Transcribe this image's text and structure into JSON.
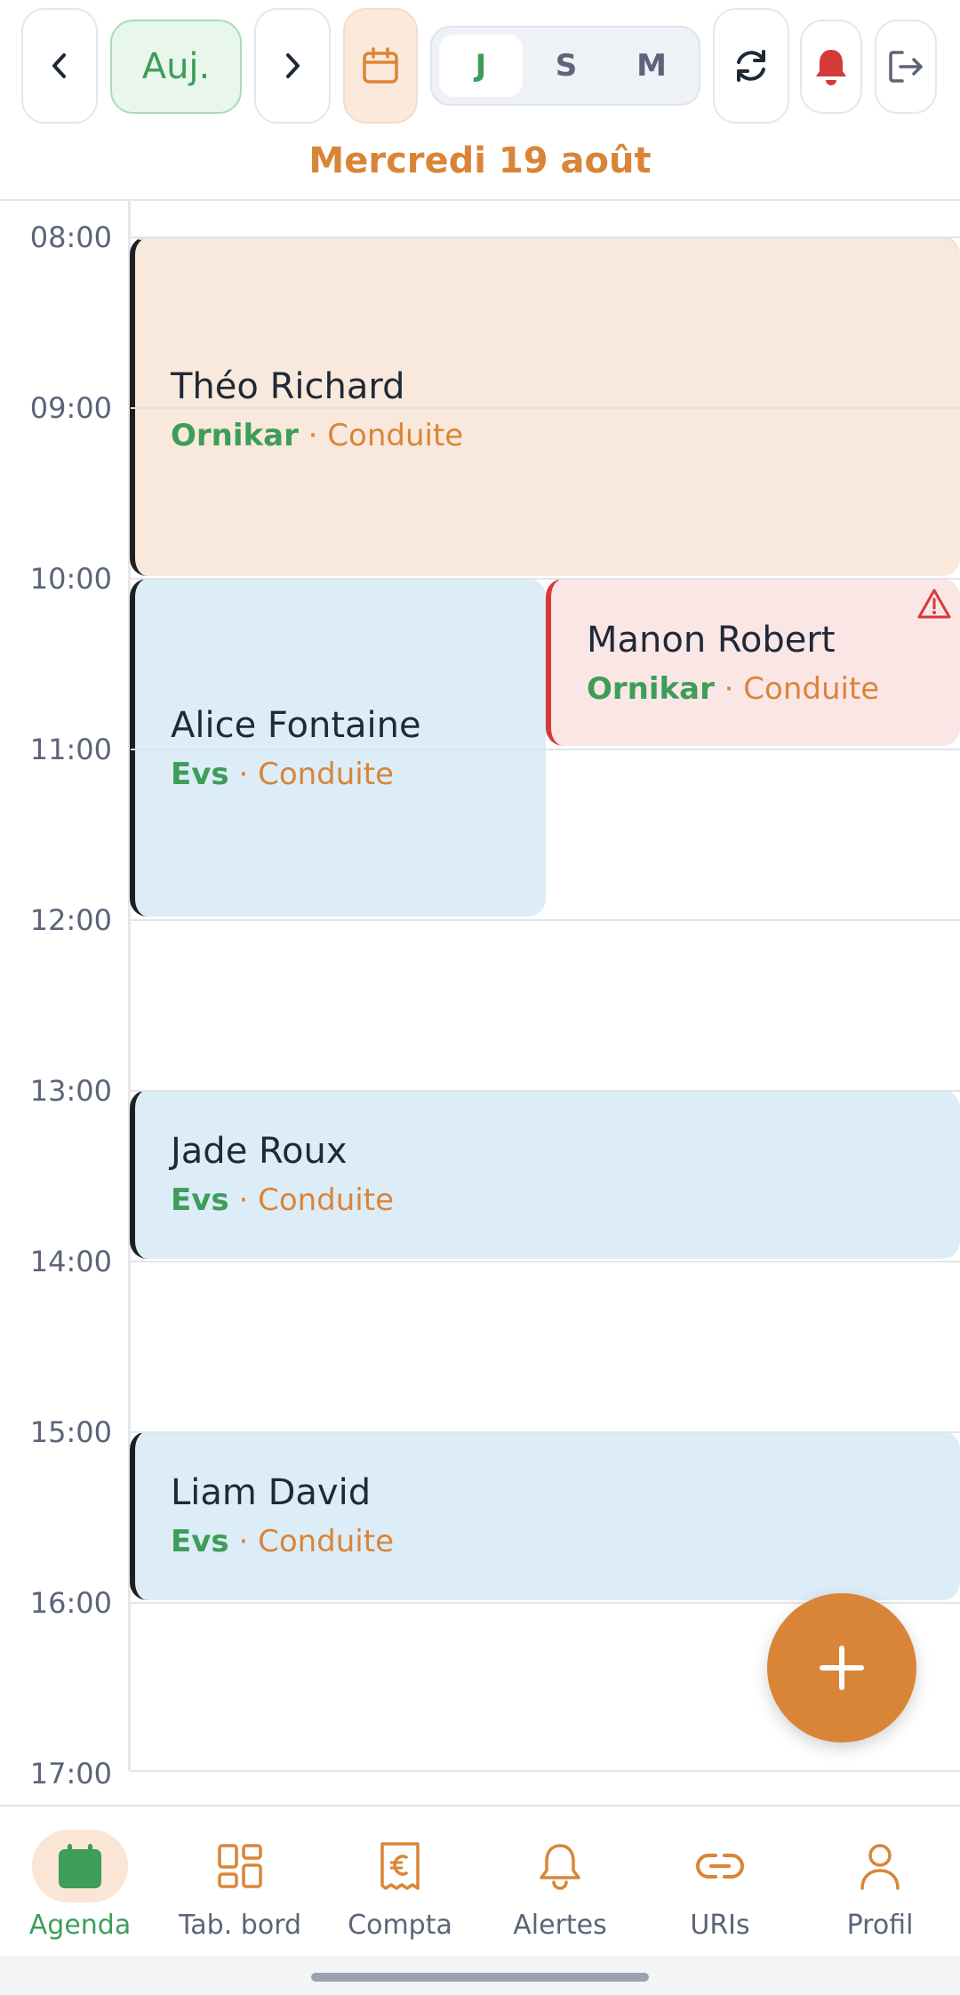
{
  "toolbar": {
    "today_label": "Auj.",
    "view_modes": [
      "J",
      "S",
      "M"
    ],
    "active_view": "J"
  },
  "date_label": "Mercredi 19 août",
  "time_labels": [
    "08:00",
    "09:00",
    "10:00",
    "11:00",
    "12:00",
    "13:00",
    "14:00",
    "15:00",
    "16:00",
    "17:00"
  ],
  "events": [
    {
      "name": "Théo Richard",
      "source": "Ornikar",
      "type": "Conduite",
      "color": "#f8e9dc"
    },
    {
      "name": "Alice Fontaine",
      "source": "Evs",
      "type": "Conduite",
      "color": "#dcedf8"
    },
    {
      "name": "Manon Robert",
      "source": "Ornikar",
      "type": "Conduite",
      "color": "#fbe6e6",
      "warning": true
    },
    {
      "name": "Jade Roux",
      "source": "Evs",
      "type": "Conduite",
      "color": "#dcedf8"
    },
    {
      "name": "Liam David",
      "source": "Evs",
      "type": "Conduite",
      "color": "#dcedf8"
    }
  ],
  "separator": "·",
  "nav": {
    "items": [
      {
        "label": "Agenda",
        "icon": "calendar-icon",
        "active": true
      },
      {
        "label": "Tab. bord",
        "icon": "dashboard-icon"
      },
      {
        "label": "Compta",
        "icon": "receipt-euro-icon"
      },
      {
        "label": "Alertes",
        "icon": "bell-icon"
      },
      {
        "label": "URIs",
        "icon": "link-icon"
      },
      {
        "label": "Profil",
        "icon": "user-icon"
      }
    ]
  },
  "colors": {
    "accent": "#d98538",
    "green": "#3e9d58",
    "alert_red": "#d53a3a"
  }
}
